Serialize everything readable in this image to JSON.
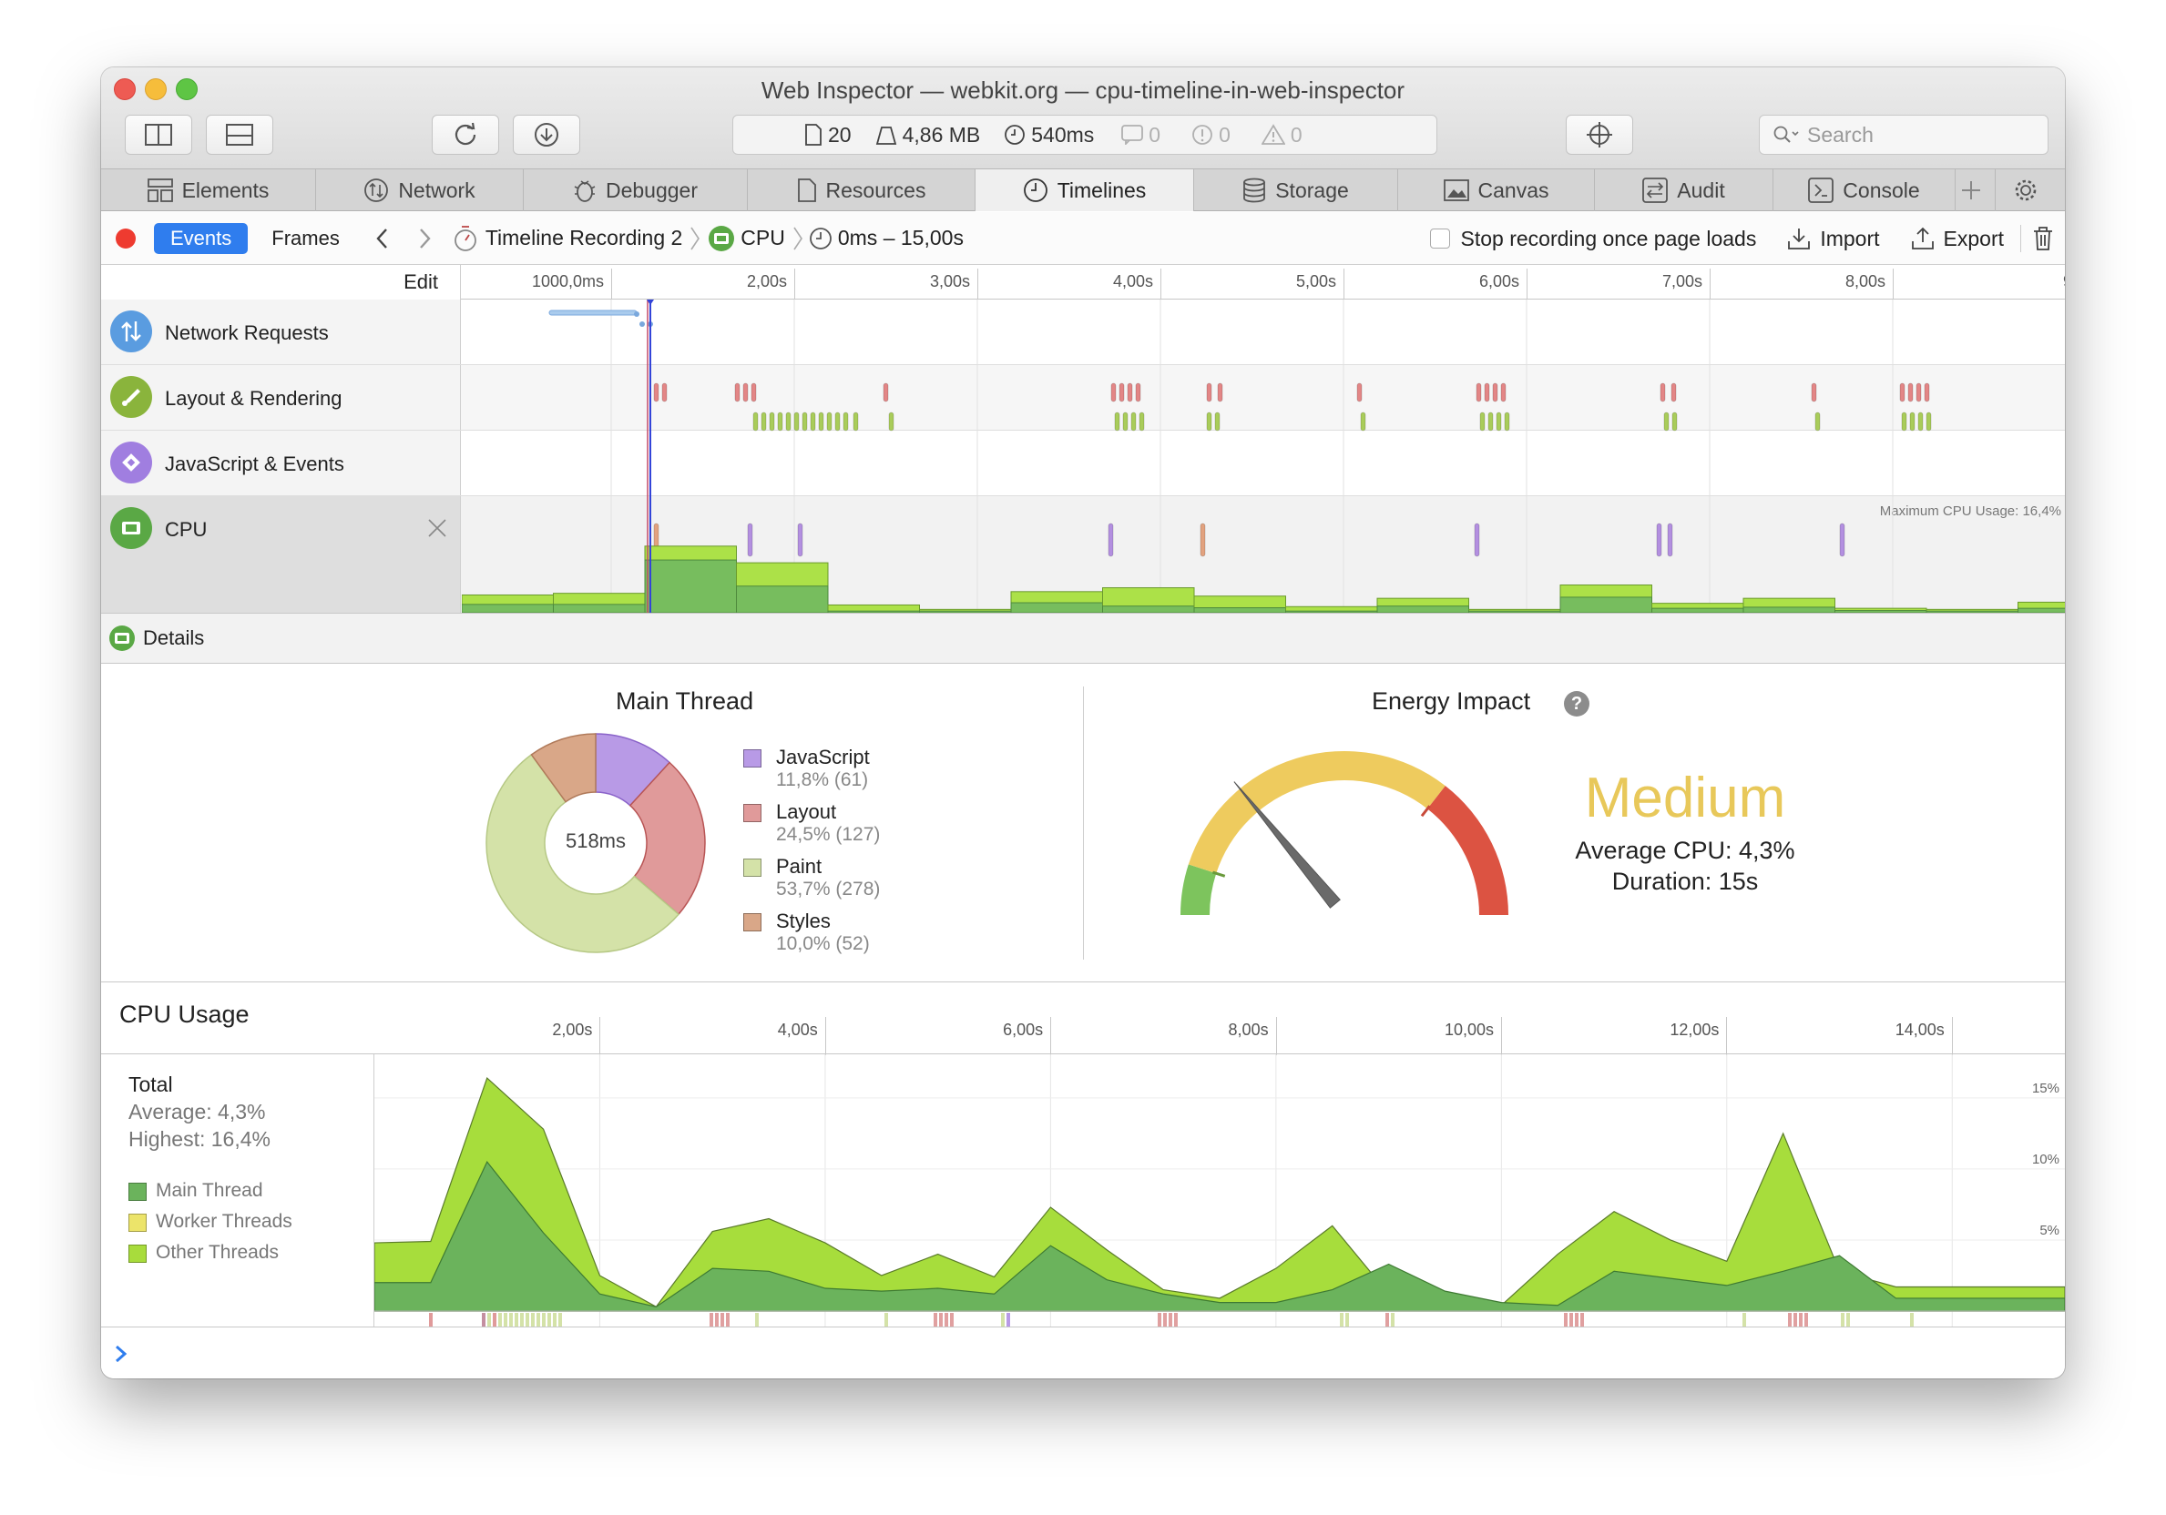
{
  "window": {
    "title": "Web Inspector — webkit.org — cpu-timeline-in-web-inspector"
  },
  "toolbar": {
    "stats": {
      "resources": "20",
      "size": "4,86 MB",
      "load_time": "540ms",
      "logs": "0",
      "errors": "0",
      "warnings": "0"
    },
    "search_placeholder": "Search"
  },
  "tabs": [
    {
      "label": "Elements",
      "icon": "elements-icon"
    },
    {
      "label": "Network",
      "icon": "network-icon"
    },
    {
      "label": "Debugger",
      "icon": "debugger-icon"
    },
    {
      "label": "Resources",
      "icon": "resources-icon"
    },
    {
      "label": "Timelines",
      "icon": "timelines-icon",
      "active": true
    },
    {
      "label": "Storage",
      "icon": "storage-icon"
    },
    {
      "label": "Canvas",
      "icon": "canvas-icon"
    },
    {
      "label": "Audit",
      "icon": "audit-icon"
    },
    {
      "label": "Console",
      "icon": "console-icon"
    }
  ],
  "navbar": {
    "mode_events": "Events",
    "mode_frames": "Frames",
    "crumb_recording": "Timeline Recording 2",
    "crumb_cpu": "CPU",
    "crumb_range": "0ms – 15,00s",
    "stop_recording_label": "Stop recording once page loads",
    "import_label": "Import",
    "export_label": "Export"
  },
  "overview": {
    "edit_label": "Edit",
    "ticks": [
      "1000,0ms",
      "2,00s",
      "3,00s",
      "4,00s",
      "5,00s",
      "6,00s",
      "7,00s",
      "8,00s",
      "9"
    ],
    "tracks": [
      {
        "name": "Network Requests",
        "icon": "network-requests-icon",
        "color": "#4a90d9"
      },
      {
        "name": "Layout & Rendering",
        "icon": "layout-rendering-icon",
        "color": "#8ab43c"
      },
      {
        "name": "JavaScript & Events",
        "icon": "javascript-events-icon",
        "color": "#9b6bd6"
      },
      {
        "name": "CPU",
        "icon": "cpu-icon",
        "color": "#5aa845"
      }
    ],
    "max_cpu_label": "Maximum CPU Usage: 16,4%",
    "cpu_bars_percent": [
      {
        "main": 1.5,
        "total": 3.2
      },
      {
        "main": 1.5,
        "total": 3.5
      },
      {
        "main": 9.5,
        "total": 12.0
      },
      {
        "main": 4.8,
        "total": 9.0
      },
      {
        "main": 0.3,
        "total": 1.4
      },
      {
        "main": 0.3,
        "total": 0.6
      },
      {
        "main": 1.8,
        "total": 3.8
      },
      {
        "main": 1.2,
        "total": 4.5
      },
      {
        "main": 0.9,
        "total": 3.0
      },
      {
        "main": 0.3,
        "total": 1.1
      },
      {
        "main": 1.2,
        "total": 2.6
      },
      {
        "main": 0.3,
        "total": 0.6
      },
      {
        "main": 2.8,
        "total": 5.0
      },
      {
        "main": 0.8,
        "total": 1.7
      },
      {
        "main": 1.0,
        "total": 2.6
      },
      {
        "main": 0.4,
        "total": 0.8
      },
      {
        "main": 0.3,
        "total": 0.6
      },
      {
        "main": 0.8,
        "total": 1.9
      }
    ]
  },
  "details": {
    "label": "Details",
    "main_thread": {
      "title": "Main Thread",
      "center_label": "518ms",
      "slices": [
        {
          "name": "JavaScript",
          "value": "11,8% (61)",
          "percent": 11.8,
          "color": "#b89ae6"
        },
        {
          "name": "Layout",
          "value": "24,5% (127)",
          "percent": 24.5,
          "color": "#e09a9a"
        },
        {
          "name": "Paint",
          "value": "53,7% (278)",
          "percent": 53.7,
          "color": "#d4e2a8"
        },
        {
          "name": "Styles",
          "value": "10,0% (52)",
          "percent": 10.0,
          "color": "#d9a788"
        }
      ]
    },
    "energy": {
      "title": "Energy Impact",
      "rating": "Medium",
      "rating_color": "#e8c85a",
      "average_cpu": "Average CPU: 4,3%",
      "duration": "Duration: 15s",
      "gauge_level": 0.28
    }
  },
  "cpu_usage": {
    "title": "CPU Usage",
    "ticks": [
      "2,00s",
      "4,00s",
      "6,00s",
      "8,00s",
      "10,00s",
      "12,00s",
      "14,00s"
    ],
    "y_ticks": [
      "15%",
      "10%",
      "5%"
    ],
    "total_label": "Total",
    "average": "Average: 4,3%",
    "highest": "Highest: 16,4%",
    "legend": [
      {
        "name": "Main Thread",
        "color": "#6bb35c"
      },
      {
        "name": "Worker Threads",
        "color": "#ece46a"
      },
      {
        "name": "Other Threads",
        "color": "#a8dc3c"
      }
    ],
    "chart_data": {
      "type": "area",
      "x": [
        0,
        0.5,
        1.0,
        1.5,
        2.0,
        2.5,
        3.0,
        3.5,
        4.0,
        4.5,
        5.0,
        5.5,
        6.0,
        6.5,
        7.0,
        7.5,
        8.0,
        8.5,
        9.0,
        9.5,
        10.0,
        10.5,
        11.0,
        11.5,
        12.0,
        12.5,
        13.0,
        13.5,
        14.0,
        14.5,
        15.0
      ],
      "series": [
        {
          "name": "Main Thread",
          "values": [
            2.0,
            2.0,
            10.5,
            5.5,
            1.2,
            0.3,
            3.0,
            2.8,
            1.6,
            1.4,
            1.6,
            1.2,
            4.6,
            2.2,
            1.2,
            0.6,
            0.6,
            1.5,
            3.3,
            1.4,
            0.6,
            0.4,
            2.8,
            2.3,
            1.8,
            2.8,
            3.9,
            0.9,
            0.9,
            0.9,
            0.9
          ]
        },
        {
          "name": "Other Threads",
          "values": [
            4.8,
            4.9,
            16.4,
            12.8,
            2.5,
            0.3,
            5.6,
            6.5,
            4.8,
            2.5,
            4.0,
            2.4,
            7.3,
            4.3,
            1.5,
            0.9,
            3.0,
            6.0,
            1.2,
            0.8,
            0.4,
            4.0,
            7.0,
            5.0,
            3.5,
            12.5,
            2.8,
            1.7,
            1.7,
            1.7,
            1.7
          ]
        }
      ],
      "xlim": [
        0,
        15
      ],
      "ylim": [
        0,
        16.4
      ]
    }
  }
}
